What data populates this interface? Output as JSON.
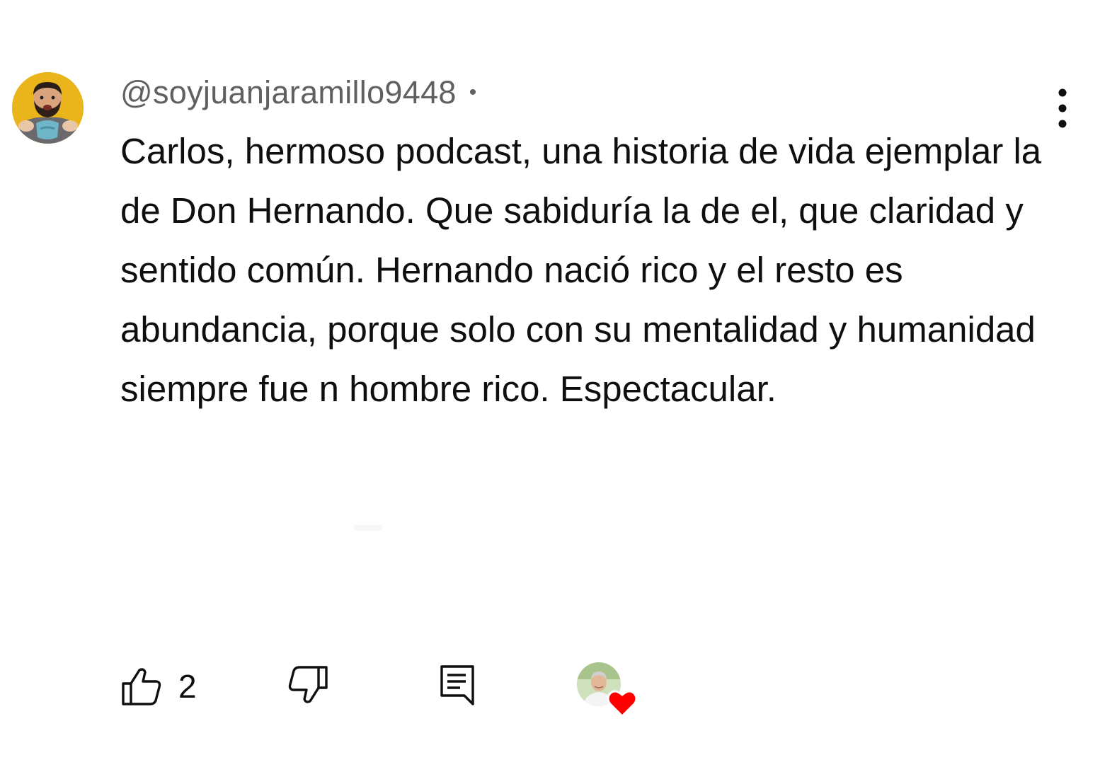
{
  "comment": {
    "author_handle": "@soyjuanjaramillo9448",
    "separator": "•",
    "timestamp": "",
    "text": "Carlos, hermoso podcast, una historia de vida ejemplar la de Don Hernando. Que sabiduría la de el, que claridad y sentido común. Hernando nació rico y el resto es abundancia, porque solo con su mentalidad y humanidad siempre fue n hombre rico. Espectacular.",
    "like_count": "2"
  },
  "icons": {
    "avatar": "user-avatar-photo",
    "more": "more-vertical-icon",
    "like": "thumb-up-icon",
    "dislike": "thumb-down-icon",
    "reply": "reply-comment-icon",
    "creator_heart": "creator-heart-badge"
  },
  "colors": {
    "text_primary": "#0f0f0f",
    "text_secondary": "#606060",
    "heart": "#ff0000",
    "avatar_bg": "#e9b51a"
  }
}
